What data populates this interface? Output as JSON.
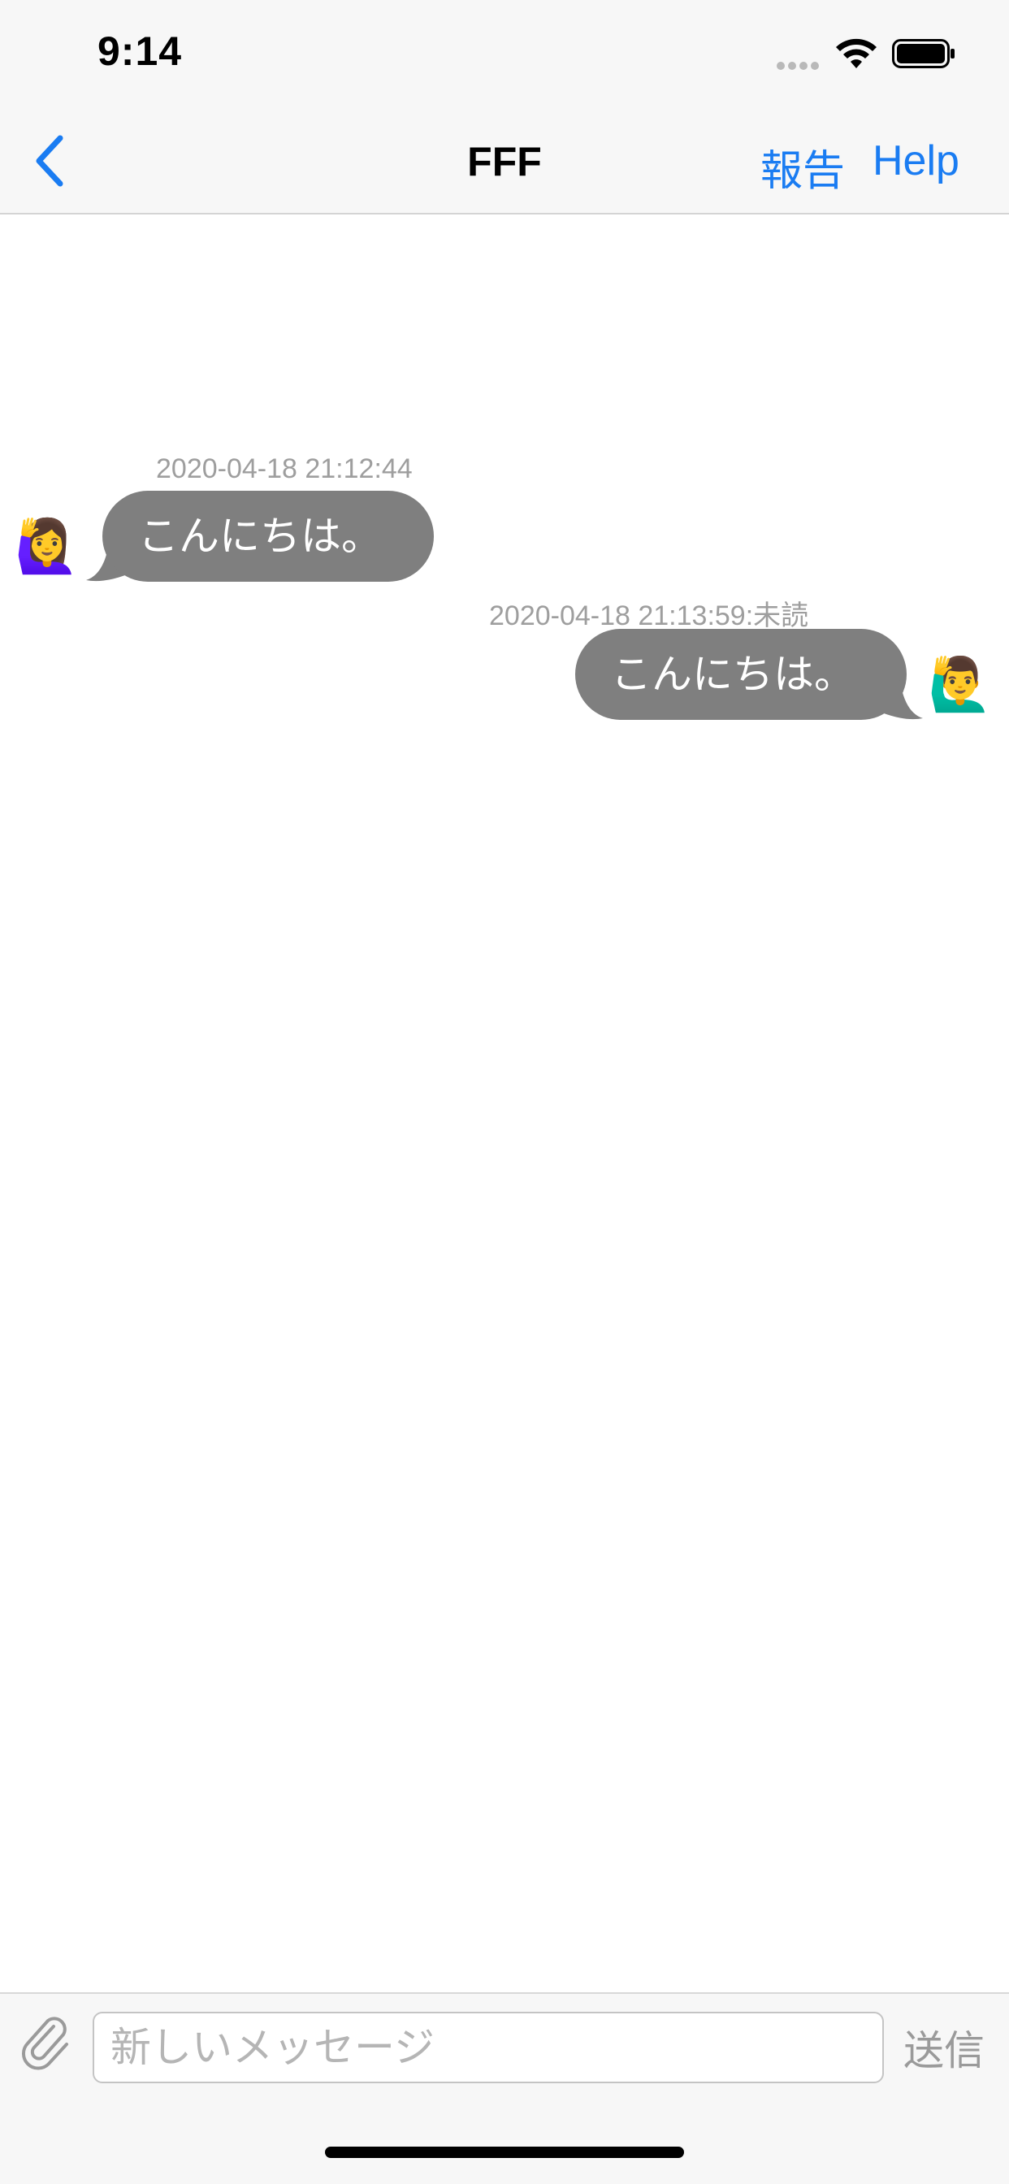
{
  "status_bar": {
    "time": "9:14"
  },
  "nav": {
    "title": "FFF",
    "report_label": "報告",
    "help_label": "Help",
    "back_icon": "chevron-left-icon",
    "accent_color": "#1a7cf2"
  },
  "messages": [
    {
      "direction": "received",
      "timestamp": "2020-04-18 21:12:44",
      "text": "こんにちは。",
      "avatar": "🙋‍♀️"
    },
    {
      "direction": "sent",
      "timestamp": "2020-04-18 21:13:59:未読",
      "text": "こんにちは。",
      "avatar": "🙋‍♂️"
    }
  ],
  "composer": {
    "placeholder": "新しいメッセージ",
    "value": "",
    "send_label": "送信",
    "attach_icon": "paperclip-icon"
  },
  "colors": {
    "bubble": "#7f7f7f",
    "timestamp": "#9e9e9e",
    "bars": "#f7f7f7"
  }
}
